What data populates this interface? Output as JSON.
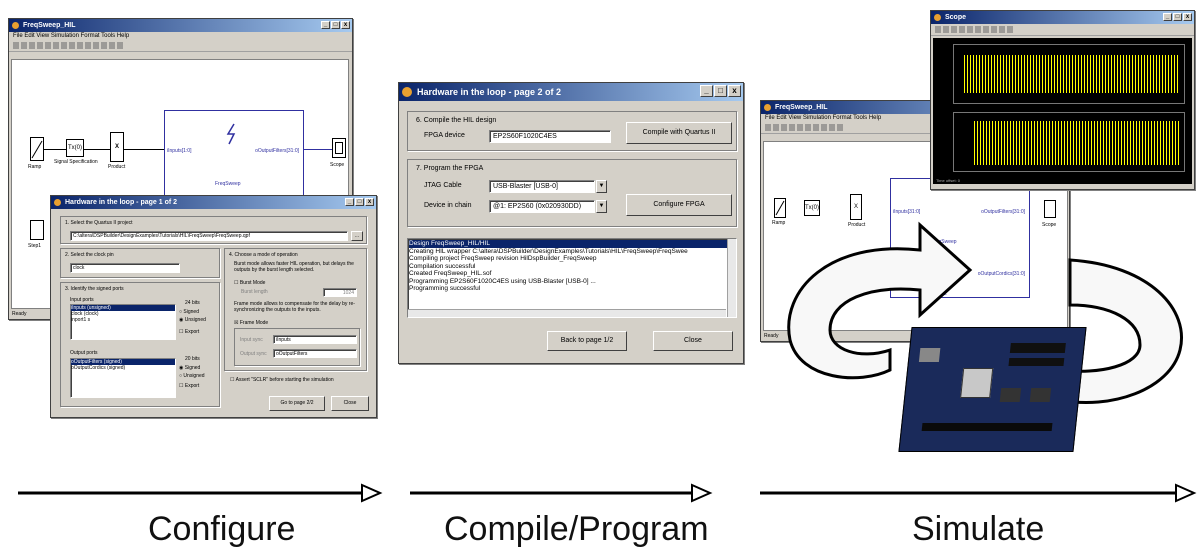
{
  "labels": {
    "configure": "Configure",
    "compile": "Compile/Program",
    "simulate": "Simulate"
  },
  "model_window": {
    "title": "FreqSweep_HIL",
    "menu": "File  Edit  View  Simulation  Format  Tools  Help",
    "status": "Ready",
    "blocks": {
      "ramp": "Ramp",
      "tx": "Tx(0)",
      "signal_spec": "Signal Specification",
      "product": "Product",
      "x": "X",
      "subsystem": "FreqSweep",
      "port_in": "iInputs[1:0]",
      "port_out": "oOutputFilters[31:0]",
      "scope": "Scope",
      "step": "Step1"
    }
  },
  "page1": {
    "title": "Hardware in the loop - page 1 of 2",
    "s1": "1. Select the Quartus II project",
    "project_path": "C:\\altera\\DSPBuilder\\DesignExamples\\Tutorials\\HIL\\FreqSweep\\FreqSweep.qpf",
    "browse": "...",
    "s2": "2. Select the clock pin",
    "clock": "clock",
    "s3": "3. Identify the signed ports",
    "input_ports_label": "Input ports",
    "input_ports": [
      "iInputs (unsigned)",
      "clock (clock)",
      "inport1 s"
    ],
    "bits_in": "24 bits",
    "signed": "Signed",
    "unsigned": "Unsigned",
    "export": "Export",
    "output_ports_label": "Output ports",
    "output_ports": [
      "oOutputFilters (signed)",
      "oOutputCordics (signed)"
    ],
    "bits_out": "20 bits",
    "s4": "4. Choose a mode of operation",
    "mode_desc": "Burst mode allows faster HIL operation, but delays the outputs by the burst length selected.",
    "burst_mode": "Burst Mode",
    "burst_length": "Burst length",
    "burst_value": "1024",
    "frame_desc": "Frame mode allows to compensate for the delay by re-synchronizing the outputs to the inputs.",
    "frame_mode": "Frame Mode",
    "input_sync": "Input sync",
    "input_sync_val": "iInputs",
    "output_sync": "Output sync",
    "output_sync_val": "oOutputFilters",
    "assert": "Assert \"SCLR\" before starting the simulation",
    "goto": "Go to page 2/2",
    "close": "Close"
  },
  "page2": {
    "title": "Hardware in the loop - page 2 of 2",
    "s6": "6. Compile the HIL design",
    "fpga_label": "FPGA device",
    "fpga_value": "EP2S60F1020C4ES",
    "compile_btn": "Compile with Quartus II",
    "s7": "7. Program the FPGA",
    "jtag_label": "JTAG Cable",
    "jtag_value": "USB-Blaster [USB-0]",
    "chain_label": "Device in chain",
    "chain_value": "@1: EP2S60 (0x020930DD)",
    "configure_btn": "Configure FPGA",
    "log": [
      "Design FreqSweep_HIL/HIL",
      "Creating HIL wrapper C:\\altera\\DSPBuilder\\DesignExamples\\Tutorials\\HIL\\FreqSweep\\FreqSwee",
      "Compiling project FreqSweep revision HilDspBuilder_FreqSweep",
      "Compilation successful",
      "Created FreqSweep_HIL.sof",
      "Programming EP2S60F1020C4ES using USB-Blaster [USB-0] ...",
      "Programming successful"
    ],
    "back_btn": "Back to page 1/2",
    "close_btn": "Close"
  },
  "scope": {
    "title": "Scope",
    "menu": "File  Edit  View  Simulation  Format  Tools  Help",
    "time_offset": "Time offset:  0"
  },
  "model2": {
    "title": "FreqSweep_HIL",
    "hil": "HIL",
    "freqsweep": "FreqSweep",
    "port_out1": "oOutputFilters[31:0]",
    "port_out2": "oOutputCordics[31:0]",
    "port_in": "iInputs[31:0]",
    "scope": "Scope",
    "ramp": "Ramp",
    "product": "Product",
    "status": "Ready"
  },
  "colors": {
    "titlebar": "#0a246a",
    "face": "#d4d0c8",
    "trace": "#ffff00",
    "board": "#1a2a5a"
  }
}
